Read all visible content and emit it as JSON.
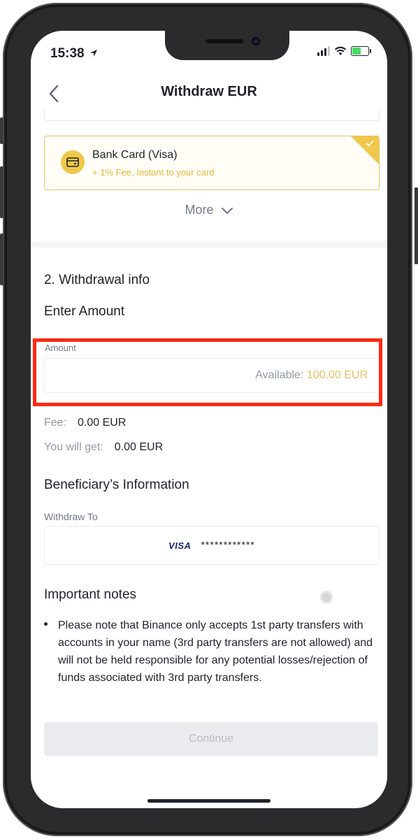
{
  "status_bar": {
    "time": "15:38"
  },
  "header": {
    "title": "Withdraw EUR",
    "back_icon": "chevron-left-icon"
  },
  "payment_method": {
    "name": "Bank Card (Visa)",
    "fee_text": "+ 1% Fee, Instant to your card",
    "selected": true,
    "accent_color": "#F0C94A"
  },
  "more": {
    "label": "More"
  },
  "withdrawal_info": {
    "section_title": "2. Withdrawal info",
    "enter_amount_title": "Enter Amount",
    "amount": {
      "label": "Amount",
      "value": "",
      "available_prefix": "Available:",
      "available_value": "100.00 EUR"
    },
    "fee": {
      "label": "Fee:",
      "value": "0.00 EUR"
    },
    "you_will_get": {
      "label": "You will get:",
      "value": "0.00 EUR"
    }
  },
  "beneficiary": {
    "title": "Beneficiary’s Information",
    "withdraw_to_label": "Withdraw To",
    "card_brand": "VISA",
    "card_masked": "************"
  },
  "notes": {
    "title": "Important notes",
    "items": [
      "Please note that Binance only accepts 1st party transfers with accounts in your name (3rd party transfers are not allowed) and will not be held responsible for any potential losses/rejection of funds associated with 3rd party transfers."
    ]
  },
  "continue_button": {
    "label": "Continue",
    "enabled": false
  },
  "colors": {
    "highlight": "#FF2A12",
    "brand_yellow": "#F0C94A",
    "text_primary": "#1E2329"
  }
}
